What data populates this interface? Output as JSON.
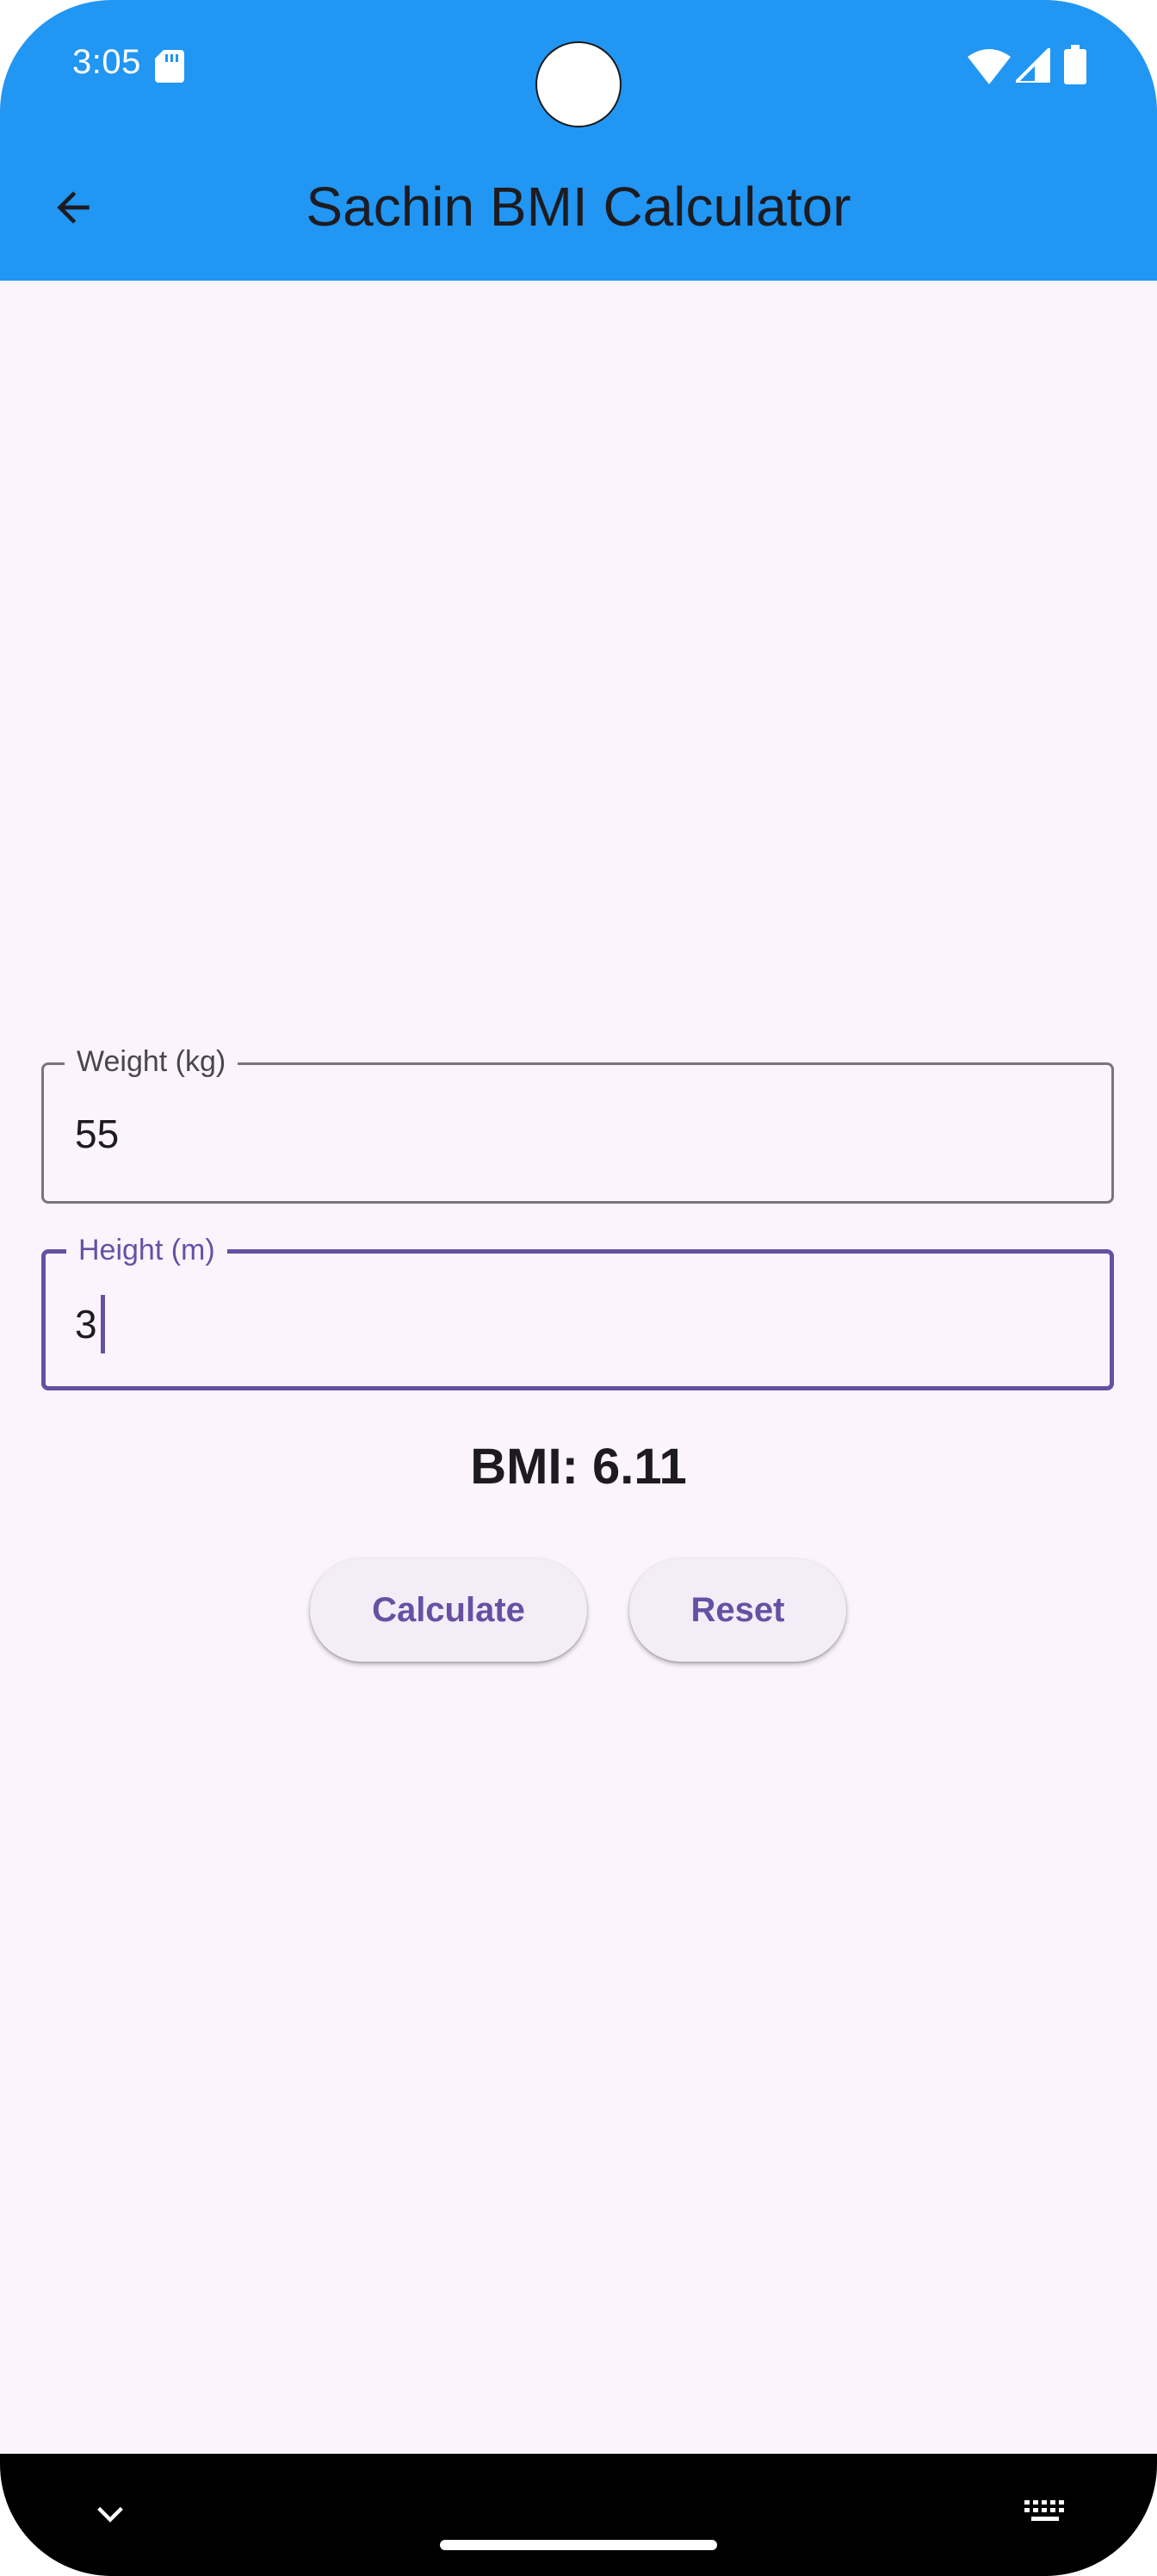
{
  "status_bar": {
    "time": "3:05",
    "icons": [
      "sd-card-icon",
      "wifi-icon",
      "cellular-signal-icon",
      "battery-icon"
    ]
  },
  "app_bar": {
    "title": "Sachin BMI Calculator",
    "back_icon": "arrow-back-icon",
    "background": "#2196f3"
  },
  "form": {
    "weight": {
      "label": "Weight (kg)",
      "value": "55"
    },
    "height": {
      "label": "Height (m)",
      "value": "3",
      "focused": true
    }
  },
  "result": {
    "text": "BMI: 6.11"
  },
  "buttons": {
    "calculate": "Calculate",
    "reset": "Reset"
  },
  "nav_bar": {
    "icons": [
      "chevron-down-icon",
      "keyboard-icon"
    ]
  },
  "colors": {
    "accent": "#6750a4",
    "background": "#fcf4fd",
    "button_bg": "#f3edf7"
  }
}
